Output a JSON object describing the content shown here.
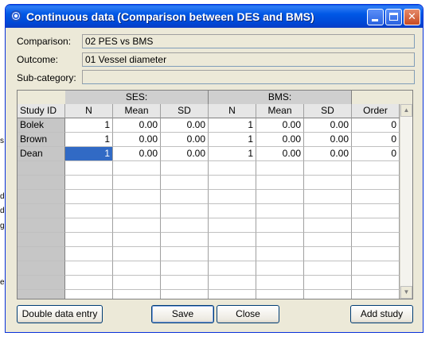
{
  "window": {
    "title": "Continuous data (Comparison between DES and BMS)"
  },
  "background_fragments": [
    "s",
    "d",
    "d",
    "g",
    "er"
  ],
  "form": {
    "comparison_label": "Comparison:",
    "comparison_value": "02 PES vs BMS",
    "outcome_label": "Outcome:",
    "outcome_value": "01 Vessel diameter",
    "subcategory_label": "Sub-category:",
    "subcategory_value": ""
  },
  "grid": {
    "group_headers": {
      "ses": "SES:",
      "bms": "BMS:"
    },
    "columns": [
      "Study ID",
      "N",
      "Mean",
      "SD",
      "N",
      "Mean",
      "SD",
      "Order"
    ],
    "rows": [
      {
        "id": "Bolek",
        "ses_n": "1",
        "ses_mean": "0.00",
        "ses_sd": "0.00",
        "bms_n": "1",
        "bms_mean": "0.00",
        "bms_sd": "0.00",
        "order": "0"
      },
      {
        "id": "Brown",
        "ses_n": "1",
        "ses_mean": "0.00",
        "ses_sd": "0.00",
        "bms_n": "1",
        "bms_mean": "0.00",
        "bms_sd": "0.00",
        "order": "0"
      },
      {
        "id": "Dean",
        "ses_n": "1",
        "ses_mean": "0.00",
        "ses_sd": "0.00",
        "bms_n": "1",
        "bms_mean": "0.00",
        "bms_sd": "0.00",
        "order": "0"
      }
    ],
    "selected_row": 2,
    "selected_column": "ses_n"
  },
  "buttons": {
    "double_entry": "Double data entry",
    "save": "Save",
    "close": "Close",
    "add_study": "Add study"
  },
  "colors": {
    "titlebar": "#0058e6",
    "selection": "#316ac5",
    "dialog_bg": "#ece9d8"
  }
}
